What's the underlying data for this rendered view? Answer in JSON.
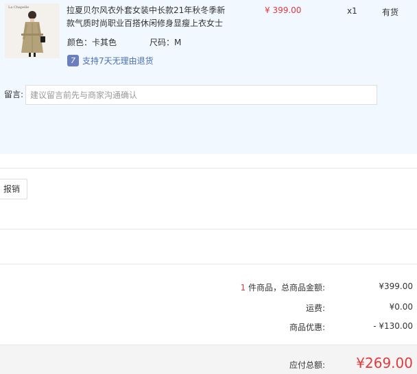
{
  "product": {
    "thumbnail_text": "La Chapelle",
    "name": "拉夏贝尔风衣外套女装中长款21年秋冬季新款气质时尚职业百搭休闲修身显瘦上衣女士",
    "price": "¥ 399.00",
    "quantity": "x1",
    "stock_status": "有货",
    "color_attr": "颜色：卡其色",
    "size_attr": "尺码：M",
    "return_badge": "7",
    "return_policy": "支持7天无理由退货"
  },
  "message": {
    "label": "留言:",
    "placeholder": "建议留言前先与商家沟通确认"
  },
  "invoice": {
    "button_label": "报销"
  },
  "summary": {
    "count": "1",
    "goods_label_suffix": " 件商品，总商品金额:",
    "goods_amount": "¥399.00",
    "shipping_label": "运费:",
    "shipping_amount": "¥0.00",
    "discount_label": "商品优惠:",
    "discount_amount": "- ¥130.00",
    "total_label": "应付总额:",
    "total_amount": "¥269.00"
  },
  "colors": {
    "accent_red": "#e4393c",
    "panel_bg": "#f1f8ff",
    "link_blue": "#4a6fb5"
  }
}
